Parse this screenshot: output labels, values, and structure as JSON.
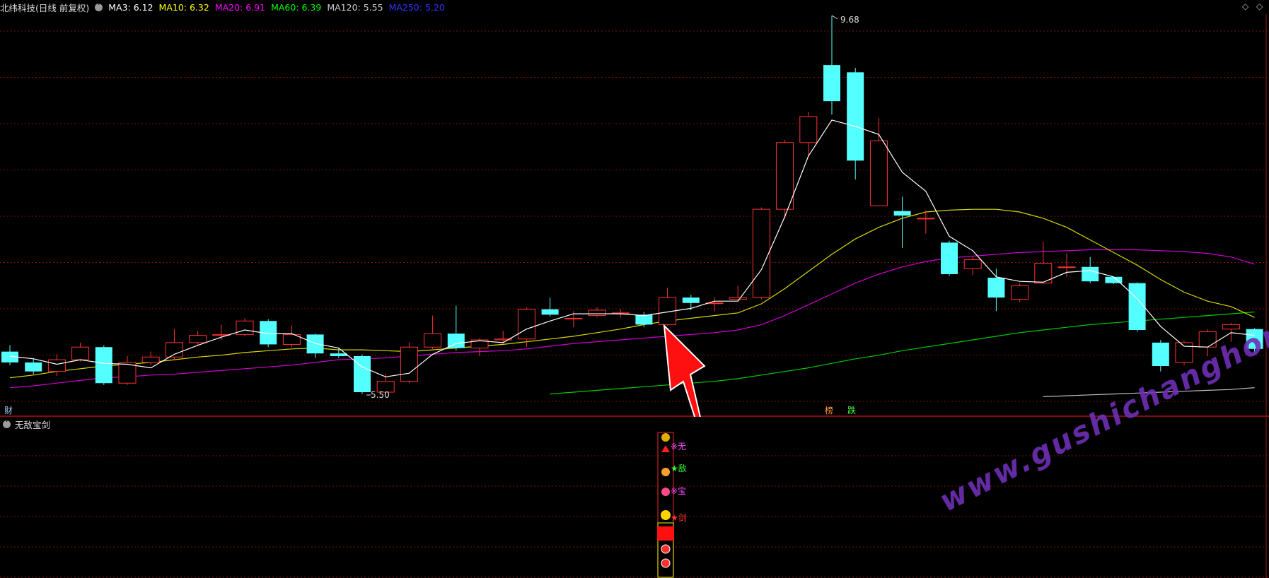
{
  "header": {
    "title": "北纬科技(日线 前复权)",
    "ma": [
      {
        "label": "MA3: 6.12",
        "color": "#ffffff"
      },
      {
        "label": "MA10: 6.32",
        "color": "#ffff00"
      },
      {
        "label": "MA20: 6.91",
        "color": "#ff00ff"
      },
      {
        "label": "MA60: 6.39",
        "color": "#00ff00"
      },
      {
        "label": "MA120: 5.55",
        "color": "#cccccc"
      },
      {
        "label": "MA250: 5.20",
        "color": "#3333ff"
      }
    ]
  },
  "chart": {
    "high_label": "9.68",
    "low_label": "5.50",
    "bottom_marks": {
      "cai": "财",
      "bang": "榜",
      "die": "跌"
    },
    "candles": [
      [
        5.95,
        5.83,
        6.02,
        5.8
      ],
      [
        5.83,
        5.73,
        5.88,
        5.7
      ],
      [
        5.73,
        5.86,
        5.92,
        5.68
      ],
      [
        5.86,
        6.0,
        6.05,
        5.84
      ],
      [
        6.0,
        5.6,
        6.02,
        5.58
      ],
      [
        5.6,
        5.83,
        5.9,
        5.58
      ],
      [
        5.83,
        5.89,
        5.95,
        5.8
      ],
      [
        5.89,
        6.05,
        6.2,
        5.86
      ],
      [
        6.05,
        6.13,
        6.18,
        6.02
      ],
      [
        6.13,
        6.14,
        6.25,
        6.08
      ],
      [
        6.14,
        6.29,
        6.32,
        6.12
      ],
      [
        6.29,
        6.03,
        6.31,
        6.0
      ],
      [
        6.03,
        6.14,
        6.24,
        6.0
      ],
      [
        6.14,
        5.93,
        6.15,
        5.88
      ],
      [
        5.93,
        5.9,
        5.99,
        5.88
      ],
      [
        5.9,
        5.5,
        5.92,
        5.48
      ],
      [
        5.5,
        5.62,
        5.7,
        5.48
      ],
      [
        5.62,
        6.0,
        6.05,
        5.6
      ],
      [
        6.0,
        6.15,
        6.35,
        5.98
      ],
      [
        6.15,
        5.99,
        6.46,
        5.96
      ],
      [
        5.99,
        6.08,
        6.1,
        5.9
      ],
      [
        6.08,
        6.09,
        6.18,
        6.04
      ],
      [
        6.09,
        6.42,
        6.44,
        6.0
      ],
      [
        6.42,
        6.36,
        6.55,
        6.34
      ],
      [
        6.32,
        6.32,
        6.4,
        6.22
      ],
      [
        6.35,
        6.41,
        6.44,
        6.33
      ],
      [
        6.38,
        6.38,
        6.42,
        6.33
      ],
      [
        6.36,
        6.25,
        6.39,
        6.22
      ],
      [
        6.25,
        6.55,
        6.66,
        6.24
      ],
      [
        6.55,
        6.49,
        6.58,
        6.41
      ],
      [
        6.49,
        6.49,
        6.55,
        6.4
      ],
      [
        6.53,
        6.55,
        6.68,
        6.5
      ],
      [
        6.55,
        7.53,
        7.55,
        6.53
      ],
      [
        7.53,
        8.27,
        8.3,
        7.43
      ],
      [
        8.27,
        8.56,
        8.61,
        8.11
      ],
      [
        9.13,
        8.73,
        9.68,
        8.58
      ],
      [
        9.05,
        8.07,
        9.1,
        7.86
      ],
      [
        7.57,
        8.29,
        8.54,
        7.59
      ],
      [
        7.51,
        7.46,
        7.67,
        7.1
      ],
      [
        7.43,
        7.43,
        7.52,
        7.26
      ],
      [
        7.16,
        6.81,
        7.18,
        6.79
      ],
      [
        6.87,
        6.97,
        7.0,
        6.8
      ],
      [
        6.77,
        6.55,
        6.87,
        6.4
      ],
      [
        6.53,
        6.68,
        6.71,
        6.5
      ],
      [
        6.71,
        6.93,
        7.17,
        6.72
      ],
      [
        6.89,
        6.89,
        7.04,
        6.78
      ],
      [
        6.89,
        6.73,
        7.0,
        6.71
      ],
      [
        6.78,
        6.71,
        6.78,
        6.7
      ],
      [
        6.71,
        6.19,
        6.72,
        6.17
      ],
      [
        6.05,
        5.79,
        6.08,
        5.73
      ],
      [
        5.83,
        6.05,
        6.07,
        5.8
      ],
      [
        6.0,
        6.17,
        6.2,
        5.9
      ],
      [
        6.2,
        6.25,
        6.27,
        6.06
      ],
      [
        6.2,
        5.98,
        6.21,
        5.93
      ]
    ],
    "ma3": [
      5.9,
      5.87,
      5.81,
      5.86,
      5.82,
      5.81,
      5.77,
      5.92,
      6.02,
      6.11,
      6.19,
      6.15,
      6.15,
      6.04,
      5.99,
      5.78,
      5.67,
      5.71,
      5.92,
      6.04,
      6.07,
      6.05,
      6.2,
      6.29,
      6.37,
      6.37,
      6.37,
      6.35,
      6.39,
      6.43,
      6.51,
      6.51,
      6.86,
      7.45,
      8.12,
      8.52,
      8.45,
      8.36,
      7.94,
      7.73,
      7.23,
      7.07,
      6.78,
      6.73,
      6.72,
      6.83,
      6.85,
      6.78,
      6.54,
      6.23,
      6.01,
      6.0,
      6.16,
      6.13
    ],
    "ma10": [
      5.66,
      5.69,
      5.73,
      5.76,
      5.79,
      5.81,
      5.83,
      5.86,
      5.89,
      5.91,
      5.94,
      5.96,
      5.98,
      5.99,
      5.97,
      5.97,
      5.96,
      5.95,
      5.97,
      5.99,
      6.01,
      6.03,
      6.06,
      6.09,
      6.12,
      6.16,
      6.2,
      6.25,
      6.29,
      6.32,
      6.35,
      6.38,
      6.48,
      6.65,
      6.84,
      7.03,
      7.2,
      7.33,
      7.43,
      7.5,
      7.52,
      7.53,
      7.53,
      7.5,
      7.43,
      7.33,
      7.19,
      7.05,
      6.91,
      6.75,
      6.61,
      6.51,
      6.45,
      6.33
    ],
    "ma20": [
      5.55,
      5.57,
      5.6,
      5.63,
      5.66,
      5.67,
      5.69,
      5.7,
      5.72,
      5.74,
      5.76,
      5.78,
      5.8,
      5.83,
      5.86,
      5.87,
      5.88,
      5.9,
      5.92,
      5.94,
      5.95,
      5.96,
      5.98,
      6.01,
      6.04,
      6.06,
      6.08,
      6.1,
      6.12,
      6.14,
      6.16,
      6.19,
      6.25,
      6.35,
      6.47,
      6.59,
      6.71,
      6.81,
      6.89,
      6.95,
      6.99,
      7.01,
      7.03,
      7.05,
      7.06,
      7.07,
      7.08,
      7.08,
      7.08,
      7.07,
      7.06,
      7.04,
      7.0,
      6.92
    ],
    "ma60": [
      null,
      null,
      null,
      null,
      null,
      null,
      null,
      null,
      null,
      null,
      null,
      null,
      null,
      null,
      null,
      null,
      null,
      null,
      null,
      null,
      null,
      null,
      null,
      5.48,
      5.5,
      5.52,
      5.54,
      5.56,
      5.58,
      5.6,
      5.62,
      5.65,
      5.69,
      5.73,
      5.77,
      5.82,
      5.87,
      5.91,
      5.96,
      6.0,
      6.04,
      6.08,
      6.12,
      6.16,
      6.19,
      6.22,
      6.25,
      6.27,
      6.29,
      6.31,
      6.33,
      6.35,
      6.37,
      6.39
    ],
    "ma120": [
      null,
      null,
      null,
      null,
      null,
      null,
      null,
      null,
      null,
      null,
      null,
      null,
      null,
      null,
      null,
      null,
      null,
      null,
      null,
      null,
      null,
      null,
      null,
      null,
      null,
      null,
      null,
      null,
      null,
      null,
      null,
      null,
      null,
      null,
      null,
      null,
      null,
      null,
      null,
      null,
      null,
      null,
      null,
      null,
      5.45,
      5.46,
      5.47,
      5.48,
      5.49,
      5.5,
      5.51,
      5.52,
      5.53,
      5.55
    ]
  },
  "sub": {
    "title": "无敌宝剑",
    "signal_labels": [
      "※无",
      "★敌",
      "※宝",
      "★剑"
    ]
  },
  "watermark": "www.gushichanghong.com"
}
